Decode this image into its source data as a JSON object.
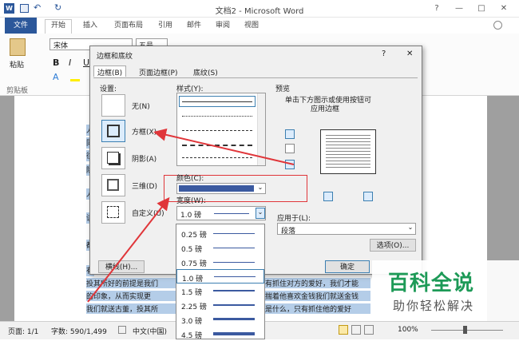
{
  "window": {
    "title": "文档2 - Microsoft Word",
    "controls": [
      "?",
      "—",
      "□",
      "✕"
    ]
  },
  "ribbon": {
    "tabs": [
      "文件",
      "开始",
      "插入",
      "页面布局",
      "引用",
      "邮件",
      "审阅",
      "视图"
    ],
    "paste": "粘贴",
    "clipboard": "剪贴板",
    "font_name": "宋体",
    "font_size": "五号",
    "bold": "B",
    "italic": "I",
    "underline": "U"
  },
  "document": {
    "lines_left": [
      "人",
      "同",
      "往",
      "除",
      "人",
      "读",
      "都",
      "有"
    ],
    "line1": "投其所好的前提是我们",
    "line1b": "有抓住对方的爱好，我们才能",
    "line2": "的印象，从而实现更",
    "line2b": "揣着他喜欢金钱我们就送金钱",
    "line3": "我们就送古董，投其所",
    "line3b": "是什么，只有抓住他的爱好"
  },
  "dialog": {
    "title": "边框和底纹",
    "help": "?",
    "close": "✕",
    "tabs": [
      "边框(B)",
      "页面边框(P)",
      "底纹(S)"
    ],
    "setting_label": "设置:",
    "settings": [
      "无(N)",
      "方框(X)",
      "阴影(A)",
      "三维(D)",
      "自定义(U)"
    ],
    "style_label": "样式(Y):",
    "color_label": "颜色(C):",
    "width_label": "宽度(W):",
    "width_value": "1.0 磅",
    "preview_label": "预览",
    "preview_hint1": "单击下方图示或使用按钮可",
    "preview_hint2": "应用边框",
    "apply_label": "应用于(L):",
    "apply_value": "段落",
    "options_button": "选项(O)...",
    "hline_button": "横线(H)...",
    "ok_button": "确定",
    "width_options": [
      "0.25 磅",
      "0.5 磅",
      "0.75 磅",
      "1.0 磅",
      "1.5 磅",
      "2.25 磅",
      "3.0 磅",
      "4.5 磅"
    ]
  },
  "status": {
    "page": "页面: 1/1",
    "words": "字数: 590/1,499",
    "lang": "中文(中国)",
    "zoom": "100%"
  },
  "watermark": {
    "main": "百科全说",
    "sub": "助你轻松解决"
  },
  "colors": {
    "accent": "#2b579a",
    "arrow": "#e0363a",
    "line": "#3b5aa0"
  }
}
